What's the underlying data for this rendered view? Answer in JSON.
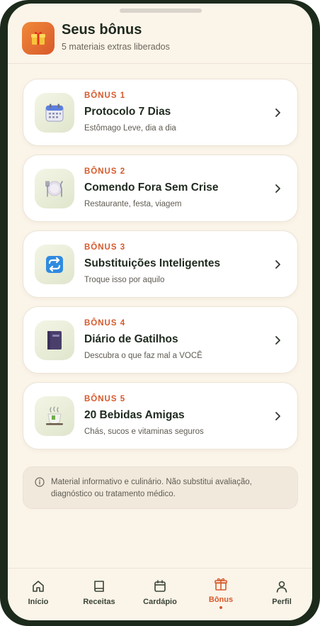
{
  "header": {
    "title": "Seus bônus",
    "subtitle": "5 materiais extras liberados",
    "icon": "gift-icon"
  },
  "bonuses": [
    {
      "tag": "BÔNUS 1",
      "title": "Protocolo 7 Dias",
      "desc": "Estômago Leve, dia a dia",
      "icon": "calendar-icon"
    },
    {
      "tag": "BÔNUS 2",
      "title": "Comendo Fora Sem Crise",
      "desc": "Restaurante, festa, viagem",
      "icon": "plate-cutlery-icon"
    },
    {
      "tag": "BÔNUS 3",
      "title": "Substituições Inteligentes",
      "desc": "Troque isso por aquilo",
      "icon": "swap-arrows-icon"
    },
    {
      "tag": "BÔNUS 4",
      "title": "Diário de Gatilhos",
      "desc": "Descubra o que faz mal a VOCÊ",
      "icon": "notebook-icon"
    },
    {
      "tag": "BÔNUS 5",
      "title": "20 Bebidas Amigas",
      "desc": "Chás, sucos e vitaminas seguros",
      "icon": "hot-tea-icon"
    }
  ],
  "disclaimer": {
    "text": "Material informativo e culinário. Não substitui avaliação, diagnóstico ou tratamento médico."
  },
  "nav": {
    "items": [
      {
        "label": "Início",
        "icon": "home-icon",
        "active": false
      },
      {
        "label": "Receitas",
        "icon": "book-icon",
        "active": false
      },
      {
        "label": "Cardápio",
        "icon": "calendar-icon",
        "active": false
      },
      {
        "label": "Bônus",
        "icon": "gift-icon",
        "active": true
      },
      {
        "label": "Perfil",
        "icon": "user-icon",
        "active": false
      }
    ]
  },
  "colors": {
    "accent": "#d65a2c",
    "background": "#fbf4e9",
    "text": "#1f2a1f",
    "frame": "#1c2a1c"
  }
}
